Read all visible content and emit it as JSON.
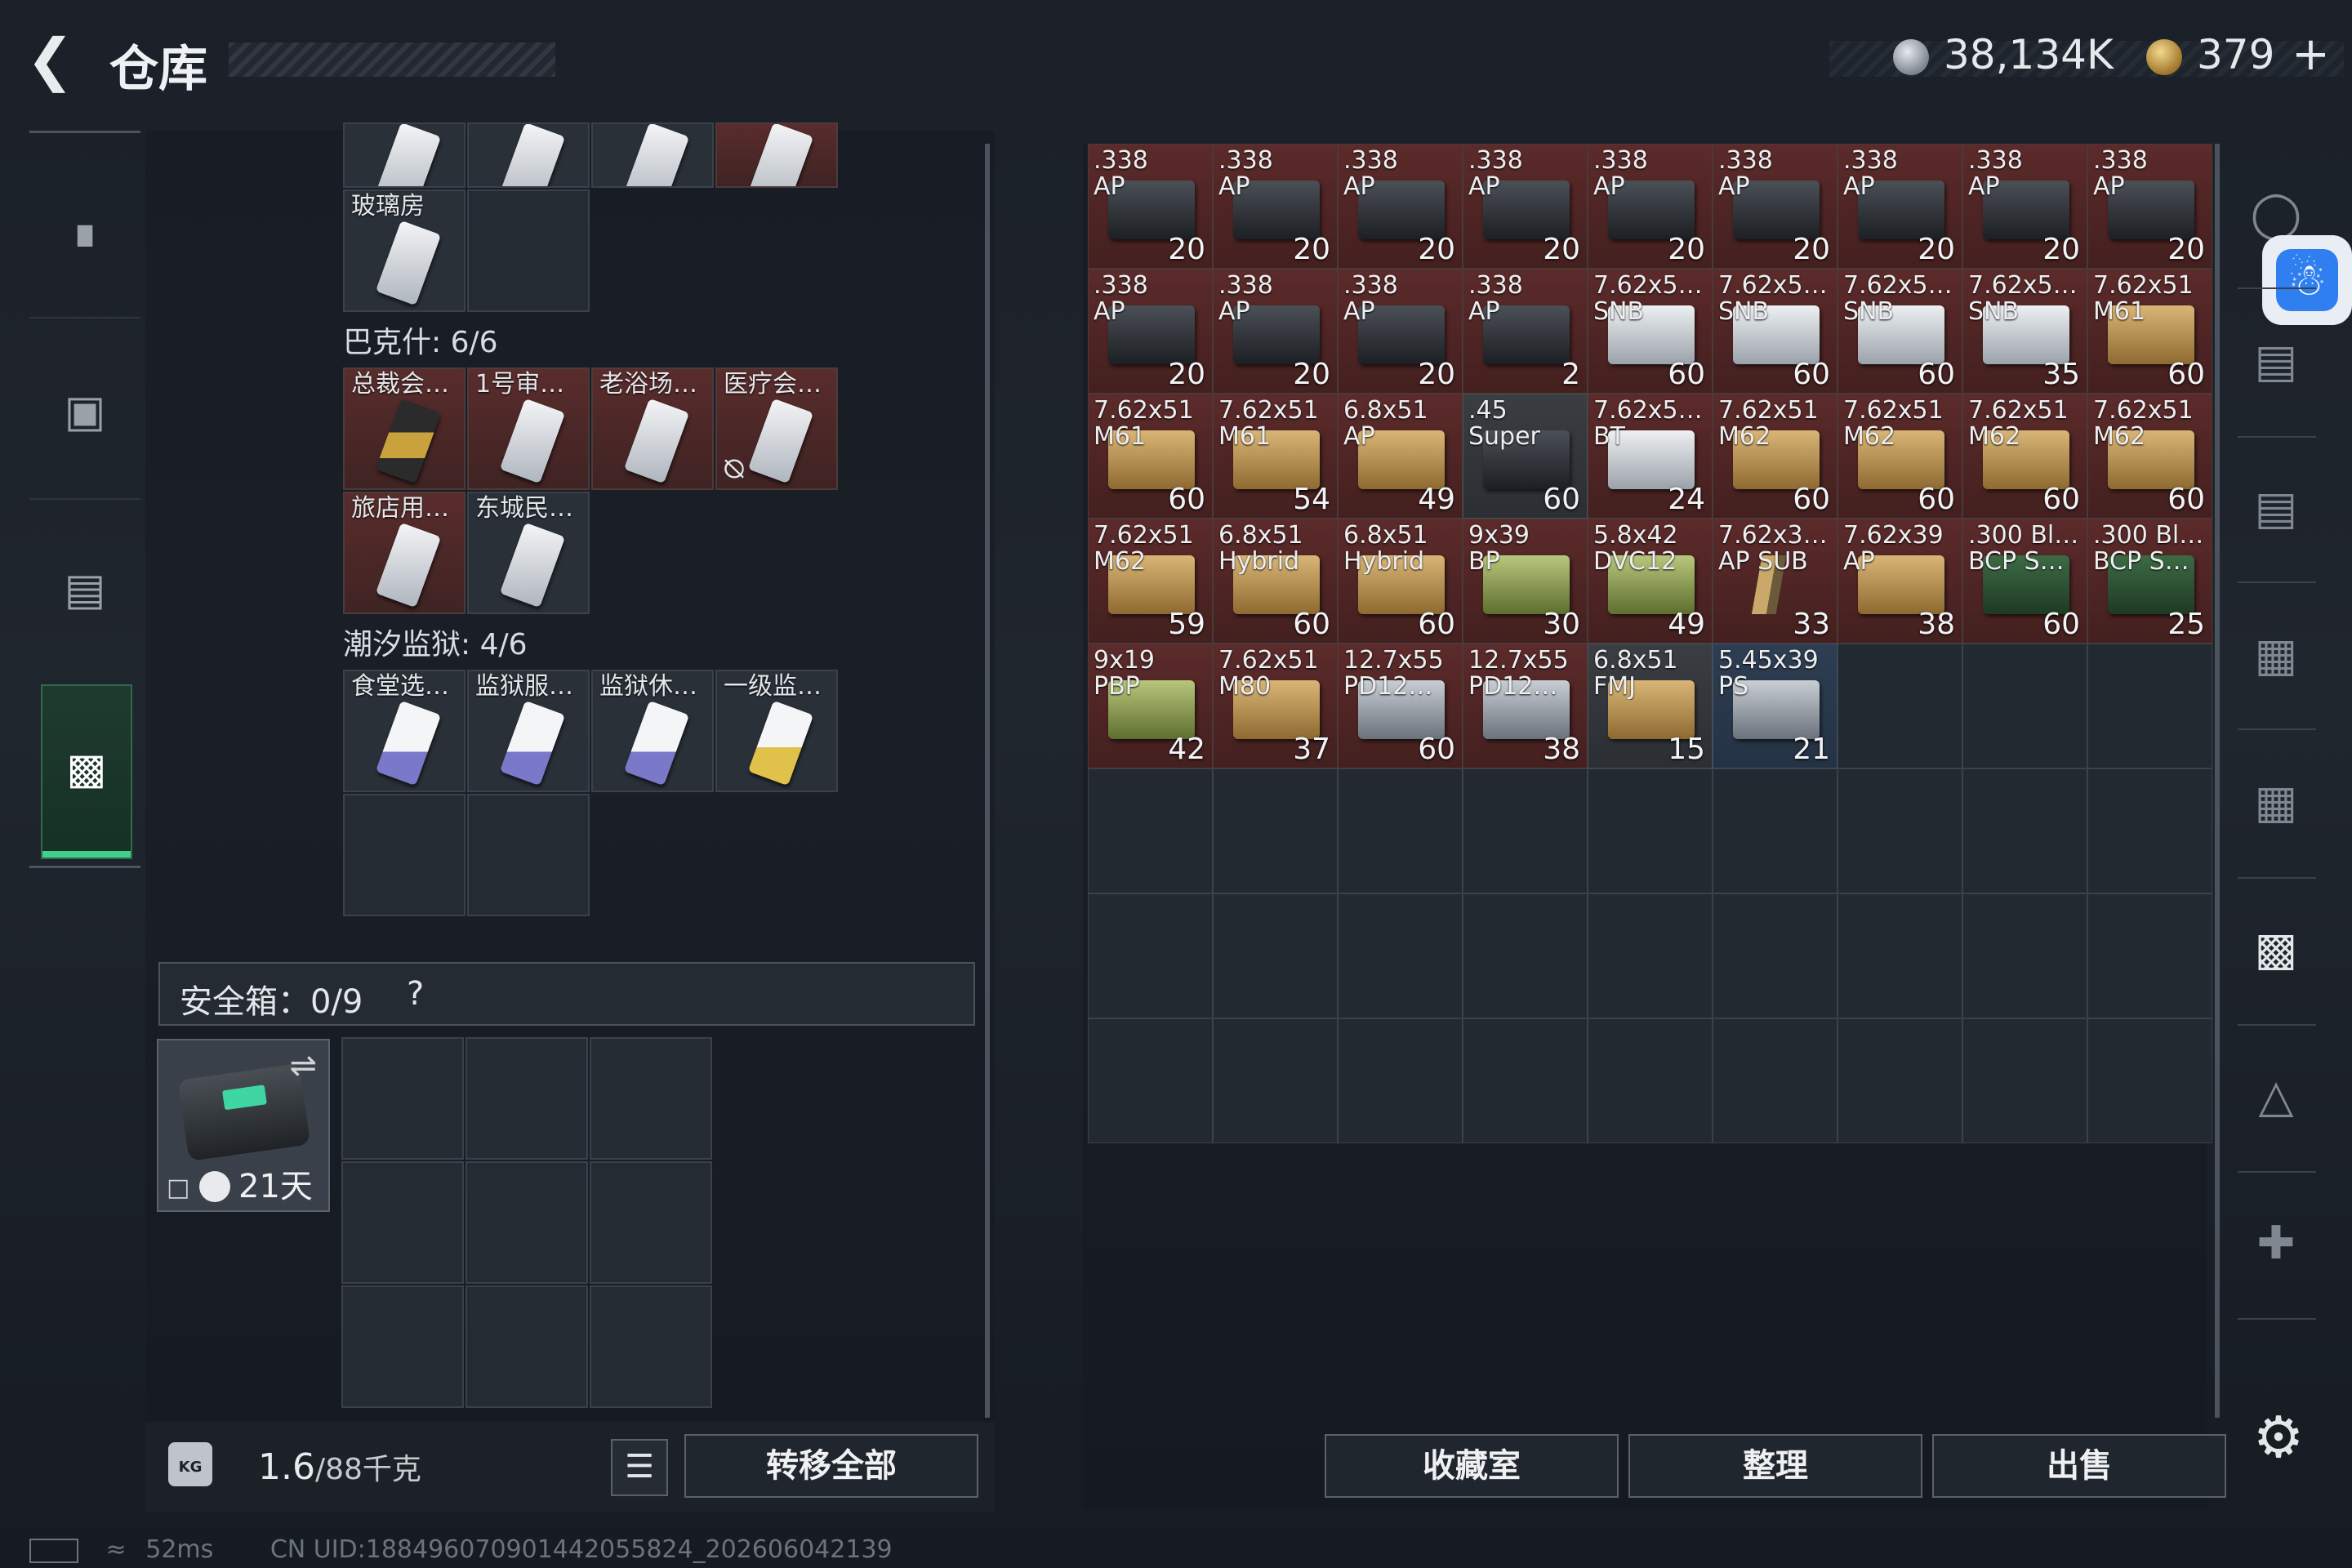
{
  "header": {
    "back_icon": "back-arrow-icon",
    "title": "仓库",
    "currency_silver": "38,134K",
    "currency_gold": "379",
    "currency_add": "+"
  },
  "nav": {
    "items": [
      {
        "name": "weapon",
        "icon": "rifle-icon"
      },
      {
        "name": "backpack",
        "icon": "backpack-icon"
      },
      {
        "name": "vest",
        "icon": "vest-icon"
      },
      {
        "name": "toolbox",
        "icon": "toolbox-icon",
        "active": true
      }
    ]
  },
  "left_panel": {
    "top_keycard_label": "玻璃房",
    "section_bakshi": {
      "title": "巴克什: 6/6",
      "items": [
        "总裁会…",
        "1号审…",
        "老浴场…",
        "医疗会…",
        "旅店用…",
        "东城民…"
      ]
    },
    "section_prison": {
      "title": "潮汐监狱: 4/6",
      "items": [
        "食堂选…",
        "监狱服…",
        "监狱休…",
        "一级监…"
      ]
    },
    "safe": {
      "title": "安全箱：0/9",
      "help": "?",
      "days": "21天"
    },
    "weight": {
      "current": "1.6",
      "max": "/88千克"
    },
    "transfer_all": "转移全部"
  },
  "ammo": [
    {
      "l1": ".338",
      "l2": "AP",
      "count": "20",
      "bg": "red",
      "art": "t-black"
    },
    {
      "l1": ".338",
      "l2": "AP",
      "count": "20",
      "bg": "red",
      "art": "t-black"
    },
    {
      "l1": ".338",
      "l2": "AP",
      "count": "20",
      "bg": "red",
      "art": "t-black"
    },
    {
      "l1": ".338",
      "l2": "AP",
      "count": "20",
      "bg": "red",
      "art": "t-black"
    },
    {
      "l1": ".338",
      "l2": "AP",
      "count": "20",
      "bg": "red",
      "art": "t-black"
    },
    {
      "l1": ".338",
      "l2": "AP",
      "count": "20",
      "bg": "red",
      "art": "t-black"
    },
    {
      "l1": ".338",
      "l2": "AP",
      "count": "20",
      "bg": "red",
      "art": "t-black"
    },
    {
      "l1": ".338",
      "l2": "AP",
      "count": "20",
      "bg": "red",
      "art": "t-black"
    },
    {
      "l1": ".338",
      "l2": "AP",
      "count": "20",
      "bg": "red",
      "art": "t-black"
    },
    {
      "l1": ".338",
      "l2": "AP",
      "count": "20",
      "bg": "red",
      "art": "t-black"
    },
    {
      "l1": ".338",
      "l2": "AP",
      "count": "20",
      "bg": "red",
      "art": "t-black"
    },
    {
      "l1": ".338",
      "l2": "AP",
      "count": "20",
      "bg": "red",
      "art": "t-black"
    },
    {
      "l1": ".338",
      "l2": "AP",
      "count": "2",
      "bg": "red",
      "art": "t-black"
    },
    {
      "l1": "7.62x5…",
      "l2": "SNB",
      "count": "60",
      "bg": "red",
      "art": "t-white"
    },
    {
      "l1": "7.62x5…",
      "l2": "SNB",
      "count": "60",
      "bg": "red",
      "art": "t-white"
    },
    {
      "l1": "7.62x5…",
      "l2": "SNB",
      "count": "60",
      "bg": "red",
      "art": "t-white"
    },
    {
      "l1": "7.62x5…",
      "l2": "SNB",
      "count": "35",
      "bg": "red",
      "art": "t-white"
    },
    {
      "l1": "7.62x51",
      "l2": "M61",
      "count": "60",
      "bg": "red",
      "art": "t-tan"
    },
    {
      "l1": "7.62x51",
      "l2": "M61",
      "count": "60",
      "bg": "red",
      "art": "t-tan"
    },
    {
      "l1": "7.62x51",
      "l2": "M61",
      "count": "54",
      "bg": "red",
      "art": "t-tan"
    },
    {
      "l1": "6.8x51",
      "l2": "AP",
      "count": "49",
      "bg": "red",
      "art": "t-tan"
    },
    {
      "l1": ".45",
      "l2": "Super",
      "count": "60",
      "bg": "dark",
      "art": "t-black"
    },
    {
      "l1": "7.62x5…",
      "l2": "BT",
      "count": "24",
      "bg": "red",
      "art": "t-white"
    },
    {
      "l1": "7.62x51",
      "l2": "M62",
      "count": "60",
      "bg": "red",
      "art": "t-tan"
    },
    {
      "l1": "7.62x51",
      "l2": "M62",
      "count": "60",
      "bg": "red",
      "art": "t-tan"
    },
    {
      "l1": "7.62x51",
      "l2": "M62",
      "count": "60",
      "bg": "red",
      "art": "t-tan"
    },
    {
      "l1": "7.62x51",
      "l2": "M62",
      "count": "60",
      "bg": "red",
      "art": "t-tan"
    },
    {
      "l1": "7.62x51",
      "l2": "M62",
      "count": "59",
      "bg": "red",
      "art": "t-tan"
    },
    {
      "l1": "6.8x51",
      "l2": "Hybrid",
      "count": "60",
      "bg": "red",
      "art": "t-tan"
    },
    {
      "l1": "6.8x51",
      "l2": "Hybrid",
      "count": "60",
      "bg": "red",
      "art": "t-tan"
    },
    {
      "l1": "9x39",
      "l2": "BP",
      "count": "30",
      "bg": "red",
      "art": "t-green"
    },
    {
      "l1": "5.8x42",
      "l2": "DVC12",
      "count": "49",
      "bg": "red",
      "art": "t-green"
    },
    {
      "l1": "7.62x3…",
      "l2": "AP SUB",
      "count": "33",
      "bg": "red",
      "art": "t-bullet"
    },
    {
      "l1": "7.62x39",
      "l2": "AP",
      "count": "38",
      "bg": "red",
      "art": "t-tan"
    },
    {
      "l1": ".300 Bl…",
      "l2": "BCP S…",
      "count": "60",
      "bg": "red",
      "art": "t-dgreen"
    },
    {
      "l1": ".300 Bl…",
      "l2": "BCP S…",
      "count": "25",
      "bg": "red",
      "art": "t-dgreen"
    },
    {
      "l1": "9x19",
      "l2": "PBP",
      "count": "42",
      "bg": "red",
      "art": "t-green"
    },
    {
      "l1": "7.62x51",
      "l2": "M80",
      "count": "37",
      "bg": "red",
      "art": "t-tan"
    },
    {
      "l1": "12.7x55",
      "l2": "PD12…",
      "count": "60",
      "bg": "red",
      "art": "t-silver"
    },
    {
      "l1": "12.7x55",
      "l2": "PD12…",
      "count": "38",
      "bg": "red",
      "art": "t-silver"
    },
    {
      "l1": "6.8x51",
      "l2": "FMJ",
      "count": "15",
      "bg": "dark",
      "art": "t-tan"
    },
    {
      "l1": "5.45x39",
      "l2": "PS",
      "count": "21",
      "bg": "blue",
      "art": "t-silver"
    }
  ],
  "actions": {
    "collection": "收藏室",
    "sort": "整理",
    "sell": "出售"
  },
  "status": {
    "ping": "52ms",
    "uid": "CN UID:18849607090144205582​4_202606042139"
  },
  "side_icons": [
    "helmet-icon",
    "armor-slot-icon",
    "armor-slot-icon",
    "armor-slot-iv-icon",
    "armor-slot-iv-icon",
    "container-iv-icon",
    "container-iv-icon",
    "medical-iv-icon",
    "armor-slot-iv-icon"
  ],
  "colors": {
    "accent": "#3fd089",
    "ammo_bg": "#5c2a2a",
    "accessibility": "#2f7ff0"
  }
}
